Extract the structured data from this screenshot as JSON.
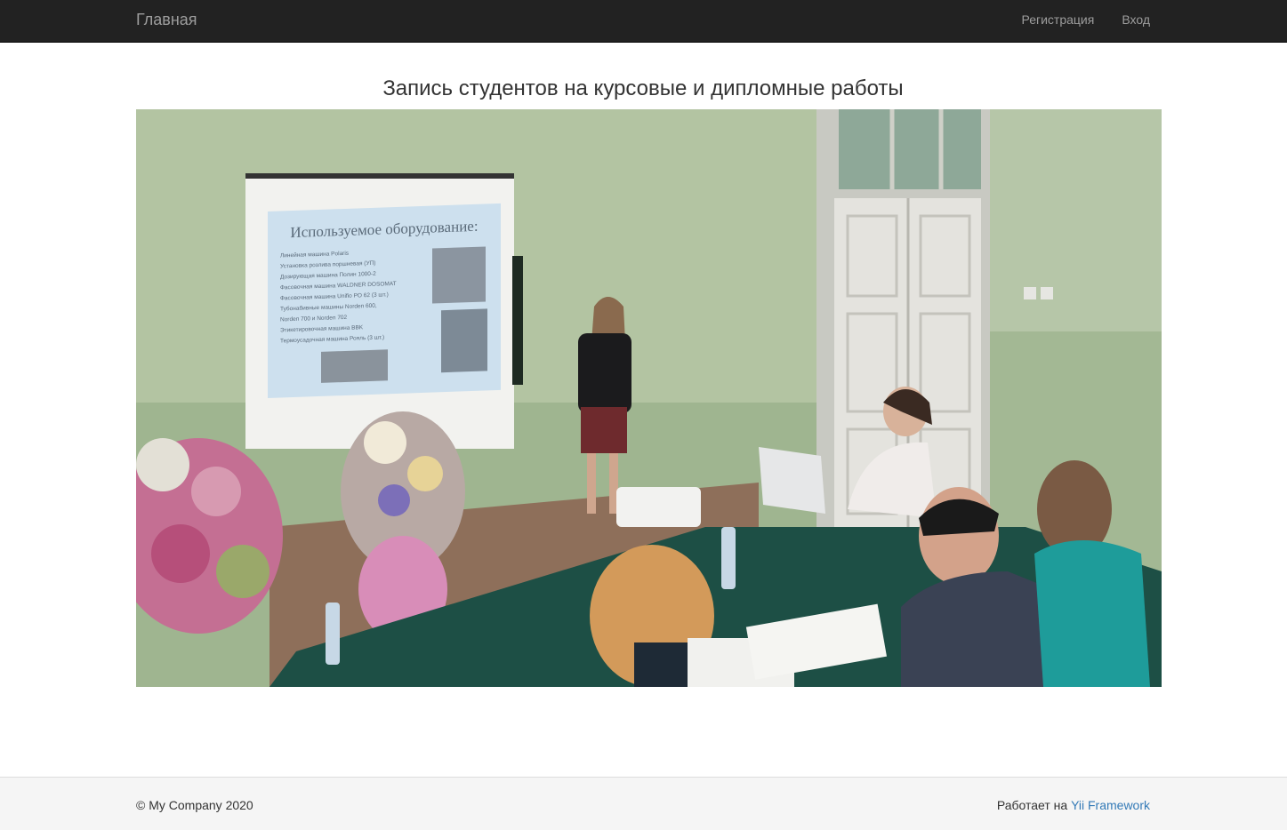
{
  "navbar": {
    "brand": "Главная",
    "links": [
      {
        "label": "Регистрация"
      },
      {
        "label": "Вход"
      }
    ]
  },
  "main": {
    "title": "Запись студентов на курсовые и дипломные работы",
    "photo": {
      "slide_heading": "Используемое оборудование:",
      "slide_items": [
        "Линейная машина Polaris",
        "Установка розлива поршневая (УП)",
        "Дозирующая машина Полин 1000-2",
        "Фасовочная машина WALDNER DOSOMAT",
        "Фасовочная машина Unifio PO 62 (3 шт.)",
        "Тубонабивные машины Norden 600,",
        "Norden 700 и Norden 702",
        "Этикетировочная машина BBK",
        "Термоусадочная машина Рояль (3 шт.)"
      ]
    }
  },
  "footer": {
    "copyright": "© My Company 2020",
    "powered_prefix": "Работает на",
    "powered_link": "Yii Framework"
  }
}
